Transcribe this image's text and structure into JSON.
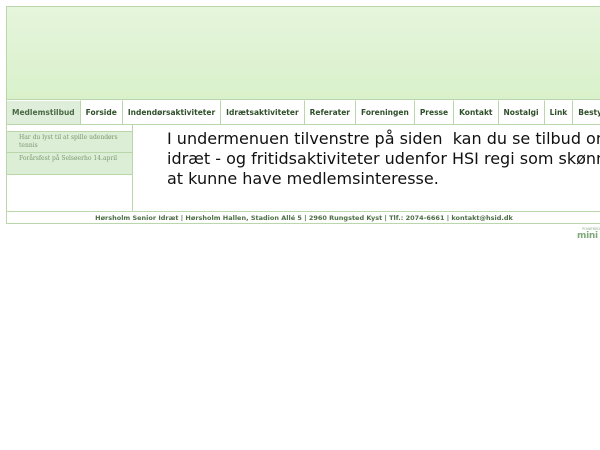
{
  "nav": {
    "items": [
      {
        "label": "Medlemstilbud",
        "active": true
      },
      {
        "label": "Forside"
      },
      {
        "label": "Indendørsaktiviteter"
      },
      {
        "label": "Idrætsaktiviteter"
      },
      {
        "label": "Referater"
      },
      {
        "label": "Foreningen"
      },
      {
        "label": "Presse"
      },
      {
        "label": "Kontakt"
      },
      {
        "label": "Nostalgi"
      },
      {
        "label": "Link"
      },
      {
        "label": "Bestyrelsens ege"
      }
    ]
  },
  "submenu": {
    "items": [
      {
        "label": "Har du lyst til at spille udendørs tennis"
      },
      {
        "label": "Forårsfest på Selsøerho 14.april"
      }
    ]
  },
  "main": {
    "text": "I undermenuen tilvenstre på siden  kan du se tilbud om\nidræt - og fritidsaktiviteter udenfor HSI regi som skønnes\nat kunne have medlemsinteresse."
  },
  "footer": {
    "text": "Hørsholm Senior Idræt | Hørsholm Hallen, Stadion Allé 5 | 2960 Rungsted Kyst | Tlf.: 2074-6661 | kontakt@hsid.dk"
  },
  "powered": {
    "small": "POWERED",
    "brand": "mini"
  },
  "colors": {
    "banner": "#d9f1cb",
    "border": "#b9d7ab",
    "submenu_bg": "#dceed5",
    "footer_text": "#4d6e45"
  }
}
